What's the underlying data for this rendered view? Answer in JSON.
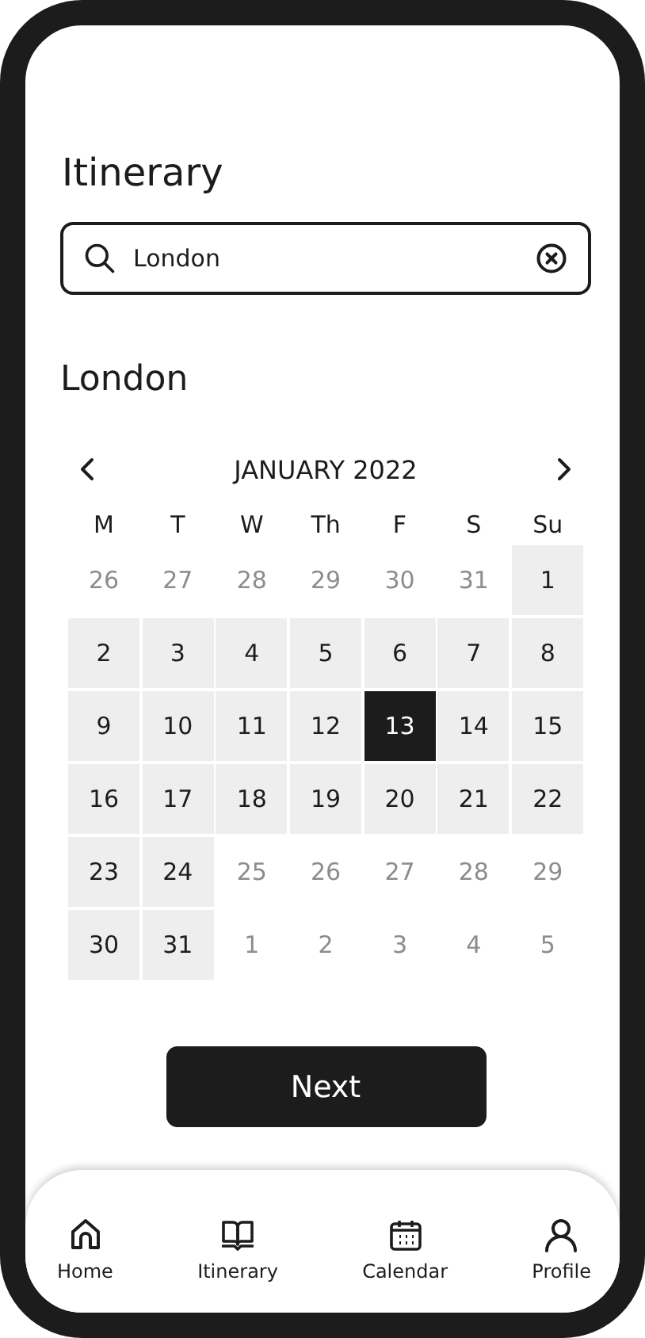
{
  "title": "Itinerary",
  "search": {
    "value": "London"
  },
  "section_title": "London",
  "calendar": {
    "month": "JANUARY 2022",
    "weekdays": [
      "M",
      "T",
      "W",
      "Th",
      "F",
      "S",
      "Su"
    ],
    "days": [
      {
        "label": "26",
        "in_month": false,
        "selected": false
      },
      {
        "label": "27",
        "in_month": false,
        "selected": false
      },
      {
        "label": "28",
        "in_month": false,
        "selected": false
      },
      {
        "label": "29",
        "in_month": false,
        "selected": false
      },
      {
        "label": "30",
        "in_month": false,
        "selected": false
      },
      {
        "label": "31",
        "in_month": false,
        "selected": false
      },
      {
        "label": "1",
        "in_month": true,
        "selected": false
      },
      {
        "label": "2",
        "in_month": true,
        "selected": false
      },
      {
        "label": "3",
        "in_month": true,
        "selected": false
      },
      {
        "label": "4",
        "in_month": true,
        "selected": false
      },
      {
        "label": "5",
        "in_month": true,
        "selected": false
      },
      {
        "label": "6",
        "in_month": true,
        "selected": false
      },
      {
        "label": "7",
        "in_month": true,
        "selected": false
      },
      {
        "label": "8",
        "in_month": true,
        "selected": false
      },
      {
        "label": "9",
        "in_month": true,
        "selected": false
      },
      {
        "label": "10",
        "in_month": true,
        "selected": false
      },
      {
        "label": "11",
        "in_month": true,
        "selected": false
      },
      {
        "label": "12",
        "in_month": true,
        "selected": false
      },
      {
        "label": "13",
        "in_month": true,
        "selected": true
      },
      {
        "label": "14",
        "in_month": true,
        "selected": false
      },
      {
        "label": "15",
        "in_month": true,
        "selected": false
      },
      {
        "label": "16",
        "in_month": true,
        "selected": false
      },
      {
        "label": "17",
        "in_month": true,
        "selected": false
      },
      {
        "label": "18",
        "in_month": true,
        "selected": false
      },
      {
        "label": "19",
        "in_month": true,
        "selected": false
      },
      {
        "label": "20",
        "in_month": true,
        "selected": false
      },
      {
        "label": "21",
        "in_month": true,
        "selected": false
      },
      {
        "label": "22",
        "in_month": true,
        "selected": false
      },
      {
        "label": "23",
        "in_month": true,
        "selected": false
      },
      {
        "label": "24",
        "in_month": true,
        "selected": false
      },
      {
        "label": "25",
        "in_month": false,
        "selected": false
      },
      {
        "label": "26",
        "in_month": false,
        "selected": false
      },
      {
        "label": "27",
        "in_month": false,
        "selected": false
      },
      {
        "label": "28",
        "in_month": false,
        "selected": false
      },
      {
        "label": "29",
        "in_month": false,
        "selected": false
      },
      {
        "label": "30",
        "in_month": true,
        "selected": false
      },
      {
        "label": "31",
        "in_month": true,
        "selected": false
      },
      {
        "label": "1",
        "in_month": false,
        "selected": false
      },
      {
        "label": "2",
        "in_month": false,
        "selected": false
      },
      {
        "label": "3",
        "in_month": false,
        "selected": false
      },
      {
        "label": "4",
        "in_month": false,
        "selected": false
      },
      {
        "label": "5",
        "in_month": false,
        "selected": false
      }
    ]
  },
  "next_button": "Next",
  "nav": [
    {
      "label": "Home",
      "kind": "home"
    },
    {
      "label": "Itinerary",
      "kind": "book"
    },
    {
      "label": "Calendar",
      "kind": "calendar"
    },
    {
      "label": "Profile",
      "kind": "person"
    }
  ]
}
